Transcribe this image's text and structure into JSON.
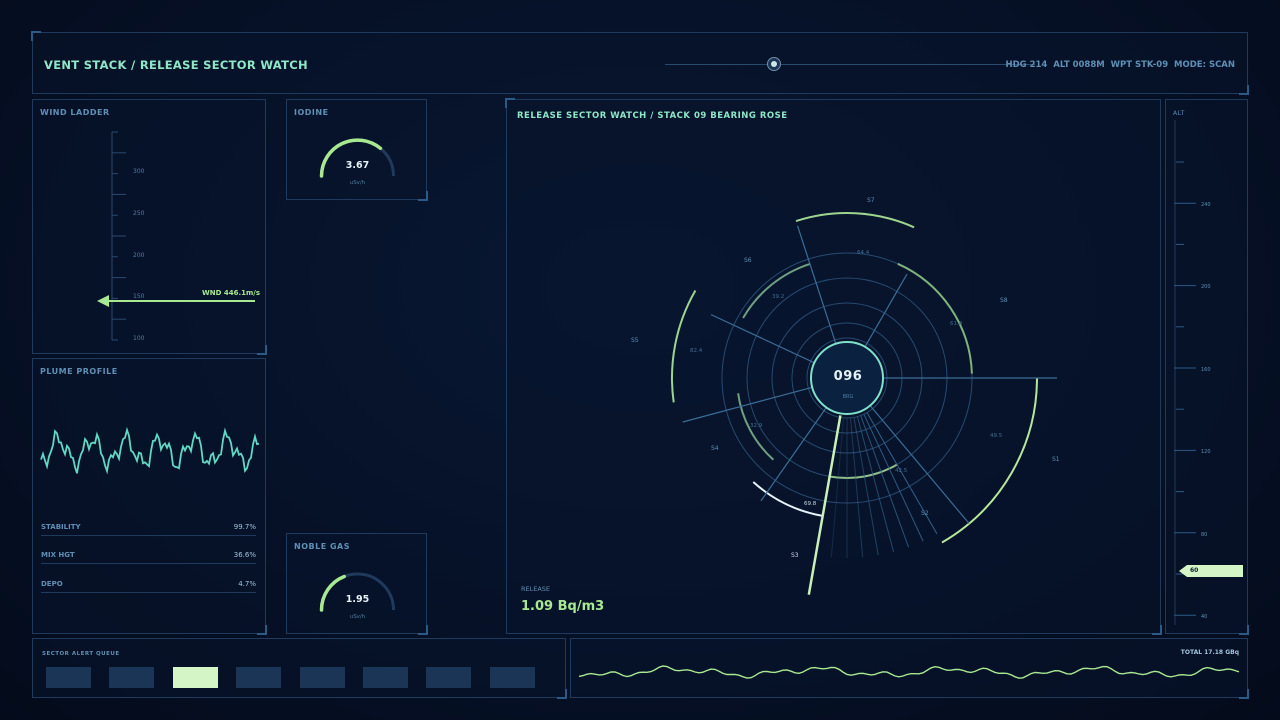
{
  "header": {
    "title": "VENT STACK / RELEASE SECTOR WATCH",
    "status": "HDG 214  ALT 0088M  WPT STK-09  MODE: SCAN"
  },
  "wind_ladder": {
    "title": "WIND LADDER",
    "ticks": [
      "300",
      "250",
      "200",
      "150",
      "100"
    ],
    "pointer_label": "WND 446.1m/s"
  },
  "iodine": {
    "title": "IODINE",
    "value": "3.67",
    "unit": "uSv/h",
    "fraction": 0.72
  },
  "noble_gas": {
    "title": "NOBLE GAS",
    "value": "1.95",
    "unit": "uSv/h",
    "fraction": 0.38
  },
  "plume": {
    "title": "PLUME PROFILE",
    "stats": [
      {
        "label": "STABILITY",
        "value": "99.7%"
      },
      {
        "label": "MIX HGT",
        "value": "36.6%"
      },
      {
        "label": "DEPO",
        "value": "4.7%"
      }
    ]
  },
  "rose": {
    "title": "RELEASE SECTOR WATCH / STACK 09  BEARING ROSE",
    "center_value": "096",
    "center_unit": "BRG",
    "sector_labels": [
      "S7",
      "S8",
      "S1",
      "S2",
      "S3",
      "S4",
      "S5",
      "S6"
    ],
    "ring_values": [
      "64.4",
      "61.8",
      "49.5",
      "42.5",
      "69.8",
      "32.9",
      "82.4",
      "39.2"
    ],
    "release_label": "RELEASE",
    "release_value": "1.09 Bq/m3"
  },
  "altitude": {
    "title": "ALT",
    "ticks": [
      "240",
      "200",
      "160",
      "120",
      "80",
      "40"
    ],
    "pointer_value": "60"
  },
  "alert_queue": {
    "title": "SECTOR ALERT QUEUE",
    "active_index": 2,
    "count": 8
  },
  "total": {
    "label": "TOTAL 17.18 GBq"
  },
  "colors": {
    "accent": "#8fe6c6",
    "green": "#a8e890",
    "panel_border": "#1f3a5c"
  }
}
